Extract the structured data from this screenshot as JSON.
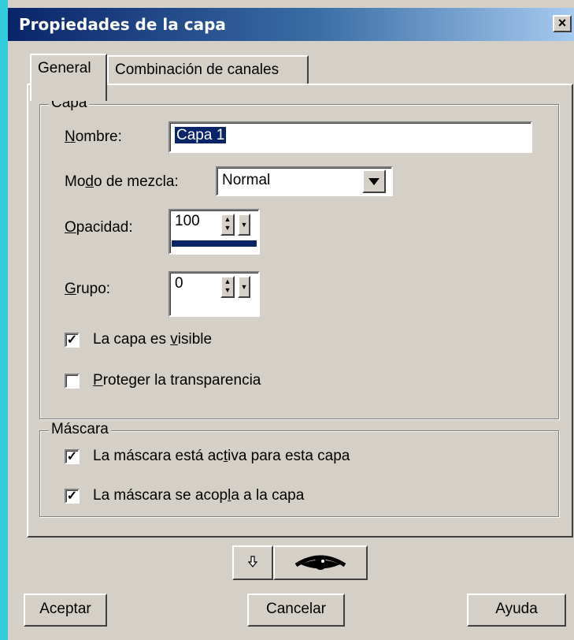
{
  "window": {
    "title": "Propiedades de la capa",
    "close": "×"
  },
  "tabs": [
    {
      "label": "General",
      "active": true
    },
    {
      "label": "Combinación de canales",
      "active": false
    }
  ],
  "capa": {
    "legend": "Capa",
    "nombre_label": "Nombre:",
    "nombre_value": "Capa 1",
    "modo_label": "Modo de mezcla:",
    "modo_value": "Normal",
    "opacidad_label": "Opacidad:",
    "opacidad_value": "100",
    "grupo_label": "Grupo:",
    "grupo_value": "0",
    "visible_label": "La capa es visible",
    "visible_checked": true,
    "proteger_label": "Proteger la transparencia",
    "proteger_checked": false
  },
  "mascara": {
    "legend": "Máscara",
    "activa_label": "La máscara está activa para esta capa",
    "activa_checked": true,
    "acopla_label": "La máscara se acopla a la capa",
    "acopla_checked": true
  },
  "tool_icons": {
    "arrow": "arrow-down-icon",
    "eye": "eye-icon"
  },
  "buttons": {
    "aceptar": "Aceptar",
    "cancelar": "Cancelar",
    "ayuda": "Ayuda"
  },
  "colors": {
    "titlebar_start": "#0a246a",
    "selection": "#0a246a",
    "face": "#d4d0c8"
  }
}
